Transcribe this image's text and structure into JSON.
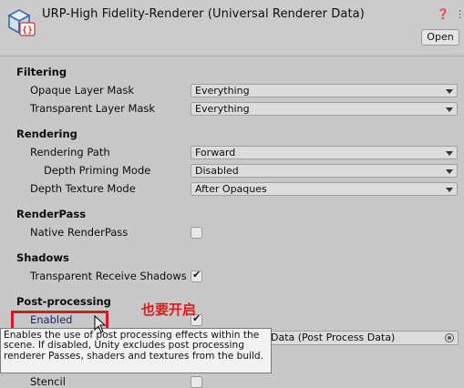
{
  "header": {
    "title": "URP-High Fidelity-Renderer (Universal Renderer Data)",
    "open_label": "Open",
    "help_icon": "help-icon",
    "settings_icon": "settings-icon",
    "menu_icon": "menu-icon"
  },
  "sections": {
    "filtering": "Filtering",
    "rendering": "Rendering",
    "renderpass": "RenderPass",
    "shadows": "Shadows",
    "postprocessing": "Post-processing"
  },
  "fields": {
    "opaque_layer_mask": {
      "label": "Opaque Layer Mask",
      "value": "Everything"
    },
    "transparent_layer_mask": {
      "label": "Transparent Layer Mask",
      "value": "Everything"
    },
    "rendering_path": {
      "label": "Rendering Path",
      "value": "Forward"
    },
    "depth_priming_mode": {
      "label": "Depth Priming Mode",
      "value": "Disabled"
    },
    "depth_texture_mode": {
      "label": "Depth Texture Mode",
      "value": "After Opaques"
    },
    "native_renderpass": {
      "label": "Native RenderPass",
      "checked": false
    },
    "transparent_receive_shadows": {
      "label": "Transparent Receive Shadows",
      "checked": true
    },
    "pp_enabled": {
      "label": "Enabled",
      "checked": true
    },
    "pp_data": {
      "value": "Data (Post Process Data)"
    },
    "stencil": {
      "label": "Stencil",
      "checked": false
    }
  },
  "tooltip": "Enables the use of post processing effects within the scene. If disabled, Unity excludes post processing renderer Passes, shaders and textures from the build.",
  "annotation": "也要开启",
  "colors": {
    "annotation": "#e01818"
  }
}
